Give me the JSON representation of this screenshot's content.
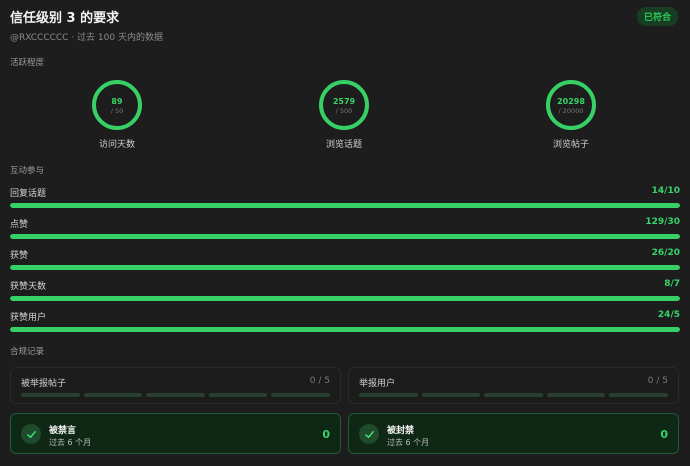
{
  "header": {
    "title": "信任级别 3 的要求",
    "status": "已符合"
  },
  "subtitle": "@RXCCCCCC · 过去 100 天内的数据",
  "activity": {
    "section_label": "活跃程度",
    "rings": [
      {
        "value": "89",
        "required": "/ 50",
        "label": "访问天数",
        "progress": 1.0
      },
      {
        "value": "2579",
        "required": "/ 500",
        "label": "浏览话题",
        "progress": 1.0
      },
      {
        "value": "20298",
        "required": "/ 20000",
        "label": "浏览帖子",
        "progress": 1.0
      }
    ]
  },
  "interaction": {
    "section_label": "互动参与",
    "bars": [
      {
        "label": "回复话题",
        "value": "14/10",
        "progress": 1.0
      },
      {
        "label": "点赞",
        "value": "129/30",
        "progress": 1.0
      },
      {
        "label": "获赞",
        "value": "26/20",
        "progress": 1.0
      },
      {
        "label": "获赞天数",
        "value": "8/7",
        "progress": 1.0
      },
      {
        "label": "获赞用户",
        "value": "24/5",
        "progress": 1.0
      }
    ]
  },
  "compliance": {
    "section_label": "合规记录",
    "reports": [
      {
        "label": "被举报帖子",
        "count": "0 / 5"
      },
      {
        "label": "举报用户",
        "count": "0 / 5"
      }
    ],
    "penalties": [
      {
        "label": "被禁言",
        "period": "过去 6 个月",
        "count": "0"
      },
      {
        "label": "被封禁",
        "period": "过去 6 个月",
        "count": "0"
      }
    ]
  },
  "colors": {
    "accent": "#37d36a",
    "track": "#1f3b27",
    "background": "#1d1d1d"
  },
  "icons": {
    "penalty": "check-icon"
  }
}
